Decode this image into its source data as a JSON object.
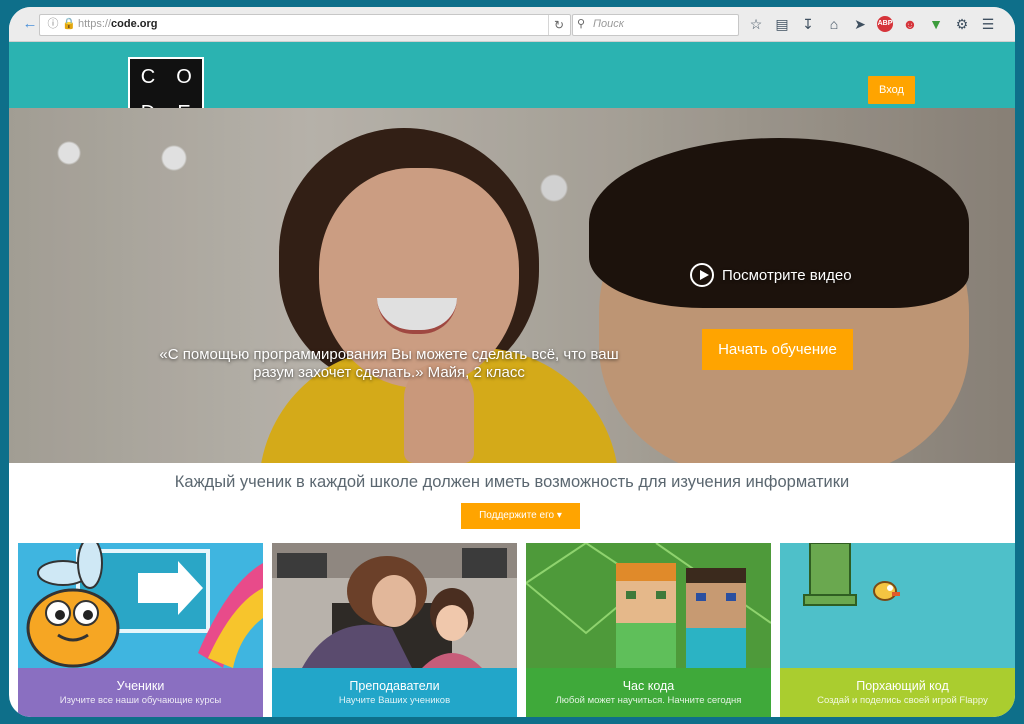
{
  "browser": {
    "url_prefix": "https://",
    "url_host": "code.org",
    "search_placeholder": "Поиск",
    "toolbar_icons": [
      "star-icon",
      "reading-list-icon",
      "download-icon",
      "home-icon",
      "pocket-icon",
      "adblock-icon",
      "smiley-icon",
      "green-extension-icon",
      "gear-icon",
      "menu-icon"
    ],
    "abp_badge": "ABP"
  },
  "header": {
    "logo_letters": [
      "C",
      "O",
      "D",
      "E"
    ],
    "signin_label": "Вход",
    "accent_color": "#2bb3b1",
    "button_color": "#ffa400"
  },
  "hero": {
    "quote_line1": "«С помощью программирования Вы можете сделать всё, что ваш",
    "quote_line2": "разум захочет сделать.» Майя, 2 класс",
    "watch_video_label": "Посмотрите видео",
    "start_button_label": "Начать обучение"
  },
  "mission": {
    "text": "Каждый ученик в каждой школе должен иметь возможность для изучения информатики",
    "donate_label": "Поддержите его"
  },
  "tiles": [
    {
      "title": "Ученики",
      "subtitle": "Изучите все наши обучающие курсы",
      "band_color": "#8a6fc1"
    },
    {
      "title": "Преподаватели",
      "subtitle": "Научите Ваших учеников",
      "band_color": "#22a6c9"
    },
    {
      "title": "Час кода",
      "subtitle": "Любой может научиться. Начните сегодня",
      "band_color": "#3fa93a"
    },
    {
      "title": "Порхающий код",
      "subtitle": "Создай и поделись своей игрой Flappy",
      "band_color": "#aacd2f"
    }
  ]
}
